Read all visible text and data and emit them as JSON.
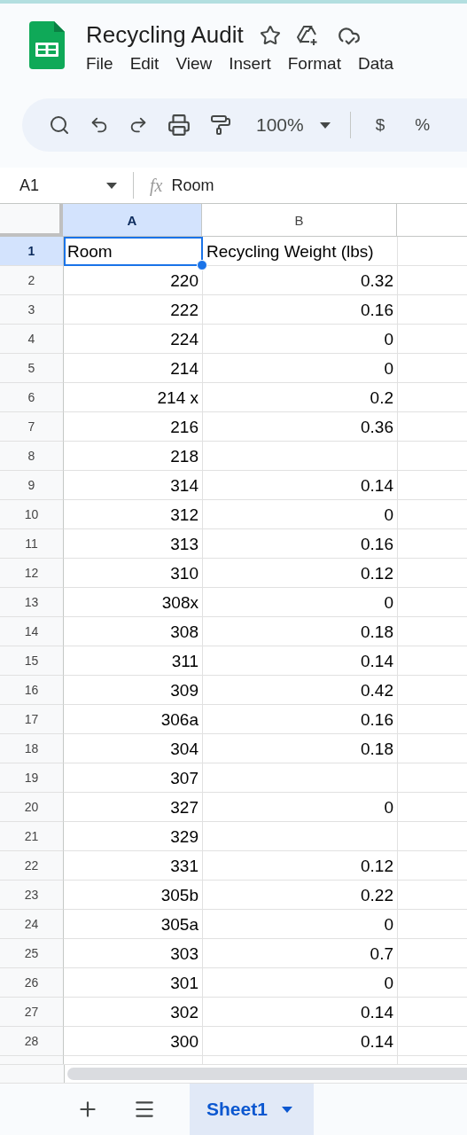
{
  "document": {
    "title": "Recycling Audit"
  },
  "menu": [
    {
      "label": "File"
    },
    {
      "label": "Edit"
    },
    {
      "label": "View"
    },
    {
      "label": "Insert"
    },
    {
      "label": "Format"
    },
    {
      "label": "Data"
    }
  ],
  "toolbar": {
    "zoom": "100%",
    "format_buttons": [
      "$",
      "%"
    ]
  },
  "formula_bar": {
    "cell_ref": "A1",
    "function_label": "fx",
    "formula": "Room"
  },
  "grid": {
    "columns": [
      {
        "label": "A",
        "selected": true
      },
      {
        "label": "B",
        "selected": false
      }
    ],
    "rows": [
      {
        "number": "1",
        "room": "Room",
        "weight": "Recycling Weight (lbs)",
        "selected": true,
        "kind": "header"
      },
      {
        "number": "2",
        "room": "220",
        "weight": "0.32",
        "selected": false
      },
      {
        "number": "3",
        "room": "222",
        "weight": "0.16",
        "selected": false
      },
      {
        "number": "4",
        "room": "224",
        "weight": "0",
        "selected": false
      },
      {
        "number": "5",
        "room": "214",
        "weight": "0",
        "selected": false
      },
      {
        "number": "6",
        "room": "214 x",
        "weight": "0.2",
        "selected": false
      },
      {
        "number": "7",
        "room": "216",
        "weight": "0.36",
        "selected": false
      },
      {
        "number": "8",
        "room": "218",
        "selected": false
      },
      {
        "number": "9",
        "room": "314",
        "weight": "0.14",
        "selected": false
      },
      {
        "number": "10",
        "room": "312",
        "weight": "0",
        "selected": false
      },
      {
        "number": "11",
        "room": "313",
        "weight": "0.16",
        "selected": false
      },
      {
        "number": "12",
        "room": "310",
        "weight": "0.12",
        "selected": false
      },
      {
        "number": "13",
        "room": "308x",
        "weight": "0",
        "selected": false
      },
      {
        "number": "14",
        "room": "308",
        "weight": "0.18",
        "selected": false
      },
      {
        "number": "15",
        "room": "311",
        "weight": "0.14",
        "selected": false
      },
      {
        "number": "16",
        "room": "309",
        "weight": "0.42",
        "selected": false
      },
      {
        "number": "17",
        "room": "306a",
        "weight": "0.16",
        "selected": false
      },
      {
        "number": "18",
        "room": "304",
        "weight": "0.18",
        "selected": false
      },
      {
        "number": "19",
        "room": "307",
        "selected": false
      },
      {
        "number": "20",
        "room": "327",
        "weight": "0",
        "selected": false
      },
      {
        "number": "21",
        "room": "329",
        "selected": false
      },
      {
        "number": "22",
        "room": "331",
        "weight": "0.12",
        "selected": false
      },
      {
        "number": "23",
        "room": "305b",
        "weight": "0.22",
        "selected": false
      },
      {
        "number": "24",
        "room": "305a",
        "weight": "0",
        "selected": false
      },
      {
        "number": "25",
        "room": "303",
        "weight": "0.7",
        "selected": false
      },
      {
        "number": "26",
        "room": "301",
        "weight": "0",
        "selected": false
      },
      {
        "number": "27",
        "room": "302",
        "weight": "0.14",
        "selected": false
      },
      {
        "number": "28",
        "room": "300",
        "weight": "0.14",
        "selected": false
      }
    ]
  },
  "sheets": [
    {
      "label": "Sheet1",
      "selected": true
    }
  ]
}
